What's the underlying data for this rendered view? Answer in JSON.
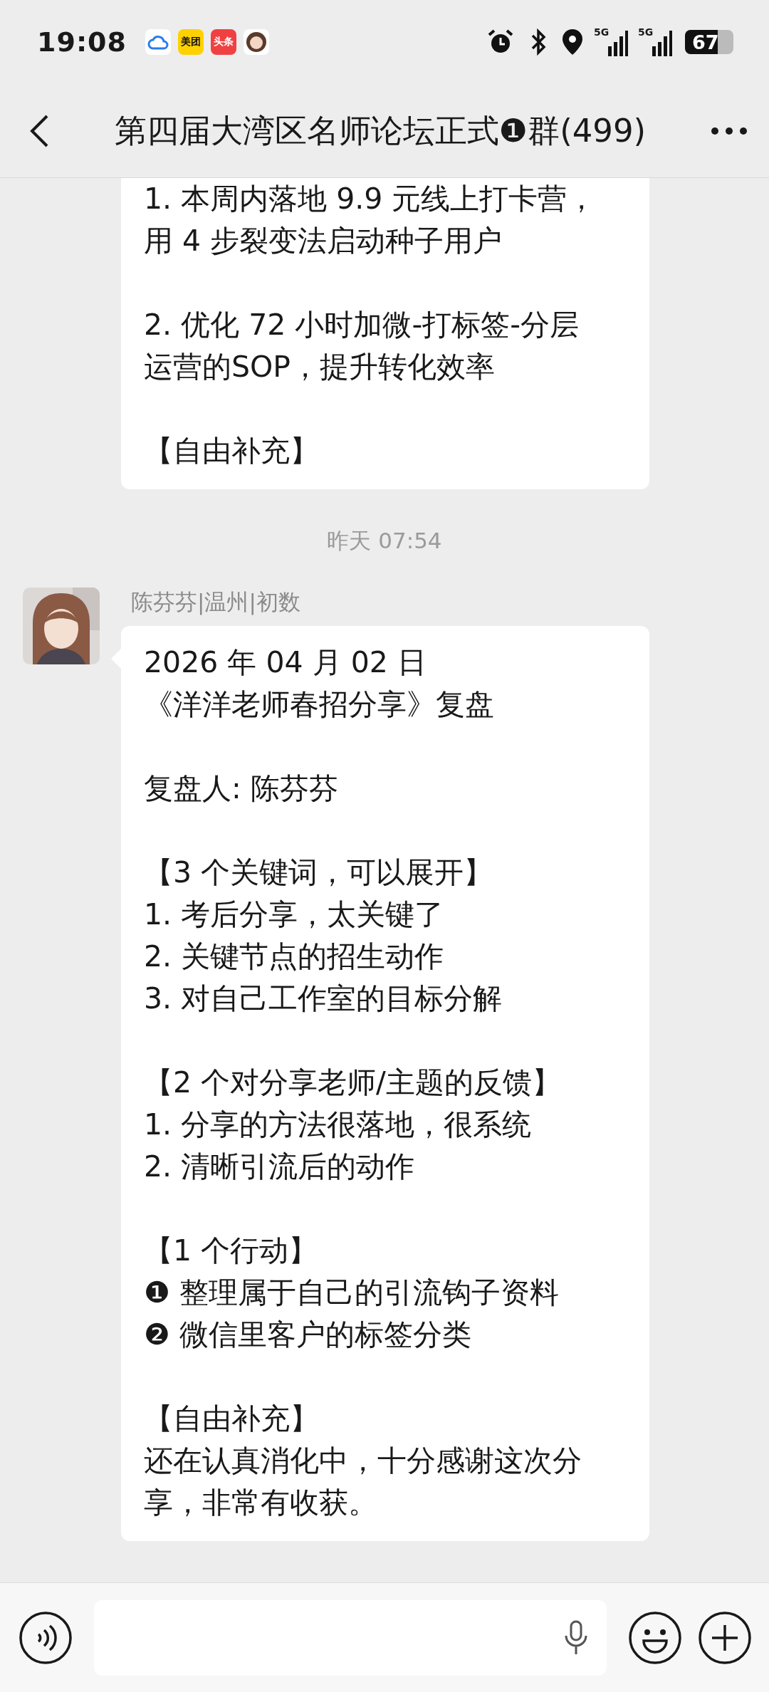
{
  "status_bar": {
    "time": "19:08",
    "notifications": [
      {
        "kind": "cloud"
      },
      {
        "kind": "badge",
        "label": "美团",
        "color": "#ffd100"
      },
      {
        "kind": "badge",
        "label": "头条",
        "color": "#f04142"
      },
      {
        "kind": "avatar"
      }
    ],
    "signals": [
      {
        "label": "5G"
      },
      {
        "label": "5G"
      }
    ],
    "battery": "67"
  },
  "header": {
    "title": "第四届大湾区名师论坛正式❶群(499)"
  },
  "messages": [
    {
      "kind": "bubble",
      "cut_top": true,
      "paragraphs": [
        [
          "1. 本周内落地 9.9 元线上打卡营，",
          "用 4 步裂变法启动种子用户"
        ],
        [
          "2. 优化 72 小时加微-打标签-分层",
          "运营的SOP，提升转化效率"
        ],
        [
          "【自由补充】"
        ]
      ]
    },
    {
      "kind": "time",
      "text": "昨天 07:54"
    },
    {
      "kind": "bubble",
      "sender": "陈芬芬|温州|初数",
      "paragraphs": [
        [
          "2026 年 04 月 02 日",
          "《洋洋老师春招分享》复盘"
        ],
        [
          "复盘人: 陈芬芬"
        ],
        [
          "【3 个关键词，可以展开】",
          "1. 考后分享，太关键了",
          "2. 关键节点的招生动作",
          "3. 对自己工作室的目标分解"
        ],
        [
          "【2 个对分享老师/主题的反馈】",
          "1. 分享的方法很落地，很系统",
          "2. 清晰引流后的动作"
        ],
        [
          "【1 个行动】",
          "❶ 整理属于自己的引流钩子资料",
          "❷ 微信里客户的标签分类"
        ],
        [
          "【自由补充】",
          "还在认真消化中，十分感谢这次分",
          "享，非常有收获。"
        ]
      ]
    }
  ]
}
